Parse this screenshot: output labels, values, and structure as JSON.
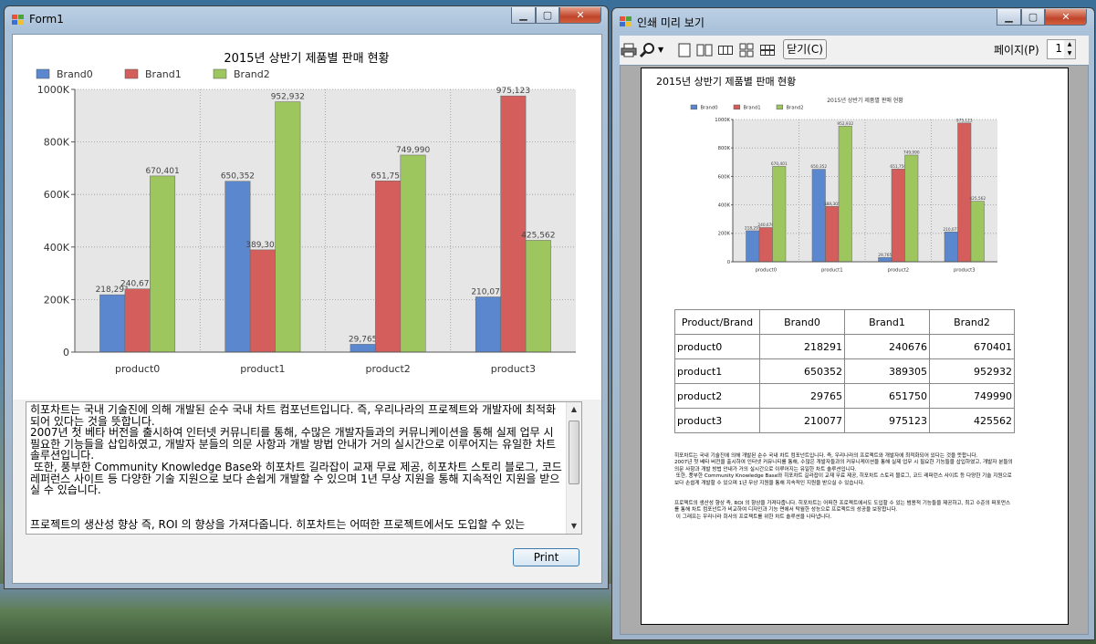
{
  "form": {
    "title": "Form1",
    "print_label": "Print",
    "memo_text": "히포차트는 국내 기술진에 의해 개발된 순수 국내 차트 컴포넌트입니다. 즉, 우리나라의 프로젝트와 개발자에 최적화되어 있다는 것을 뜻합니다.\n2007년 첫 베타 버전을 출시하여 인터넷 커뮤니티를 통해, 수많은 개발자들과의 커뮤니케이션을 통해 실제 업무 시 필요한 기능들을 삽입하였고, 개발자 분들의 의문 사항과 개발 방법 안내가 거의 실시간으로 이루어지는 유일한 차트 솔루션입니다.\n 또한, 풍부한 Community Knowledge Base와 히포차트 길라잡이 교재 무료 제공, 히포차트 스토리 블로그, 코드 레퍼런스 사이트 등 다양한 기술 지원으로 보다 손쉽게 개발할 수 있으며 1년 무상 지원을 통해 지속적인 지원을 받으실 수 있습니다.\n\n\n프로젝트의 생산성 향상 즉, ROI 의 향상을 가져다줍니다. 히포차트는 어떠한 프로젝트에서도 도입할 수 있는"
  },
  "preview": {
    "title": "인쇄 미리 보기",
    "close_label": "닫기(C)",
    "page_label": "페이지(P)",
    "page_value": "1",
    "table": {
      "headers": [
        "Product/Brand",
        "Brand0",
        "Brand1",
        "Brand2"
      ],
      "rows": [
        [
          "product0",
          "218291",
          "240676",
          "670401"
        ],
        [
          "product1",
          "650352",
          "389305",
          "952932"
        ],
        [
          "product2",
          "29765",
          "651750",
          "749990"
        ],
        [
          "product3",
          "210077",
          "975123",
          "425562"
        ]
      ]
    },
    "page_text": "히포차트는 국내 기술진에 의해 개발된 순수 국내 차트 컴포넌트입니다. 즉, 우리나라의 프로젝트와 개발자에 최적화되어 있다는 것을 뜻합니다.\n2007년 첫 베타 버전을 출시하여 인터넷 커뮤니티를 통해, 수많은 개발자들과의 커뮤니케이션을 통해 실제 업무 시 필요한 기능들을 삽입하였고, 개발자 분들의 의문 사항과 개발 방법 안내가 거의 실시간으로 이루어지는 유일한 차트 솔루션입니다.\n 또한, 풍부한 Community Knowledge Base와 히포차트 길라잡이 교재 무료 제공, 히포차트 스토리 블로그, 코드 레퍼런스 사이트 등 다양한 기술 지원으로 보다 손쉽게 개발할 수 있으며 1년 무상 지원을 통해 지속적인 지원을 받으실 수 있습니다.\n\n\n프로젝트의 생산성 향상 즉, ROI 의 향상을 가져다줍니다. 히포차트는 어떠한 프로젝트에서도 도입할 수 있는 범용적 기능들을 제공하고, 최고 수준의 퍼포먼스를 통해 차트 컴포넌트가 비교하여 디자인과 기능 면에서 탁월한 성능으로 프로젝트의 성공을 보장합니다.\n 이 그래프는 우리나라 회사의 프로젝트를 위한 차트 솔루션을 나타냅니다."
  },
  "chart_data": {
    "type": "bar",
    "title": "2015년 상반기 제품별 판매 현황",
    "categories": [
      "product0",
      "product1",
      "product2",
      "product3"
    ],
    "series": [
      {
        "name": "Brand0",
        "color": "#5b87cf",
        "values": [
          218291,
          650352,
          29765,
          210077
        ],
        "labels": [
          "218,291",
          "650,352",
          "29,765",
          "210,077"
        ]
      },
      {
        "name": "Brand1",
        "color": "#d35e5b",
        "values": [
          240676,
          389305,
          651750,
          975123
        ],
        "labels": [
          "240,676",
          "389,305",
          "651,750",
          "975,123"
        ]
      },
      {
        "name": "Brand2",
        "color": "#9ec65e",
        "values": [
          670401,
          952932,
          749990,
          425562
        ],
        "labels": [
          "670,401",
          "952,932",
          "749,990",
          "425,562"
        ]
      }
    ],
    "yticks": [
      0,
      200000,
      400000,
      600000,
      800000,
      1000000
    ],
    "ytick_labels": [
      "0",
      "200K",
      "400K",
      "600K",
      "800K",
      "1000K"
    ],
    "ylim": [
      0,
      1000000
    ],
    "legend": "top-left",
    "grid": true
  }
}
